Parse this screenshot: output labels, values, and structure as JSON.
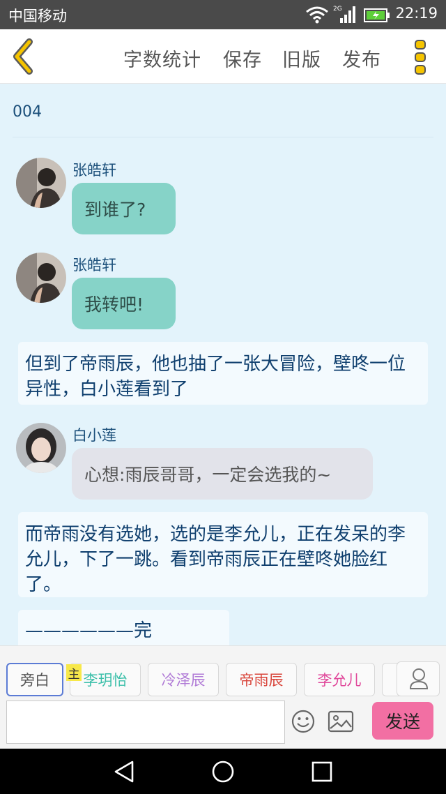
{
  "status_bar": {
    "carrier": "中国移动",
    "network": "2G",
    "time": "22:19"
  },
  "header": {
    "back_icon": "chevron-left-icon",
    "actions": [
      "字数统计",
      "保存",
      "旧版",
      "发布"
    ],
    "menu_icon": "more-vertical-icon",
    "accent_color": "#f5b800"
  },
  "chapter": {
    "title": "004"
  },
  "messages": [
    {
      "type": "dialog",
      "speaker": "张皓轩",
      "text": "到谁了?",
      "bubble_color": "#86d3c8"
    },
    {
      "type": "dialog",
      "speaker": "张皓轩",
      "text": "我转吧!",
      "bubble_color": "#86d3c8"
    },
    {
      "type": "narration",
      "text": "但到了帝雨辰，他也抽了一张大冒险，壁咚一位异性，白小莲看到了"
    },
    {
      "type": "dialog",
      "speaker": "白小莲",
      "text": "心想:雨辰哥哥，一定会选我的~",
      "bubble_color": "#e2e3ea"
    },
    {
      "type": "narration",
      "text": "而帝雨没有选她，选的是李允儿，正在发呆的李允儿，下了一跳。看到帝雨辰正在壁咚她脸红了。"
    },
    {
      "type": "narration",
      "text": "——————完—————"
    }
  ],
  "characters": [
    {
      "label": "旁白",
      "color": "#555555",
      "selected": true
    },
    {
      "label": "李玥怡",
      "color": "#3bbfa9",
      "badge": "主"
    },
    {
      "label": "冷泽辰",
      "color": "#b07ad6"
    },
    {
      "label": "帝雨辰",
      "color": "#d9453b"
    },
    {
      "label": "李允儿",
      "color": "#e0479a"
    }
  ],
  "input": {
    "value": "",
    "placeholder": ""
  },
  "toolbar": {
    "emoji_icon": "smiley-icon",
    "image_icon": "image-icon",
    "send_label": "发送",
    "send_color": "#f26fa3",
    "user_icon": "user-icon"
  }
}
